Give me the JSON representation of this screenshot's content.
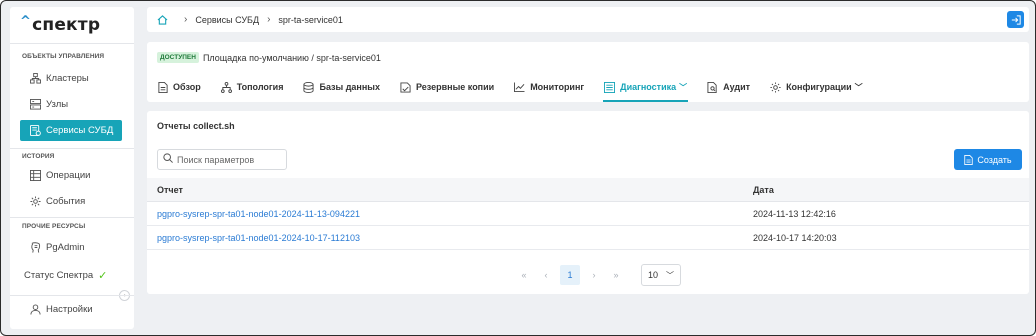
{
  "app": {
    "logo_caret": "^",
    "logo_text": "спектр"
  },
  "sidebar": {
    "sections": {
      "managed_objects": "ОБЪЕКТЫ УПРАВЛЕНИЯ",
      "history": "ИСТОРИЯ",
      "other": "ПРОЧИЕ РЕСУРСЫ"
    },
    "items": [
      {
        "label": "Кластеры",
        "icon": "cluster-icon"
      },
      {
        "label": "Узлы",
        "icon": "server-icon"
      },
      {
        "label": "Сервисы СУБД",
        "icon": "database-service-icon",
        "active": true
      },
      {
        "label": "Операции",
        "icon": "operations-icon"
      },
      {
        "label": "События",
        "icon": "events-icon"
      },
      {
        "label": "PgAdmin",
        "icon": "pgadmin-icon"
      },
      {
        "label": "Статус Спектра",
        "icon": "check-icon"
      },
      {
        "label": "Настройки",
        "icon": "user-icon"
      }
    ]
  },
  "breadcrumb": {
    "items": [
      "Сервисы СУБД",
      "spr-ta-service01"
    ]
  },
  "header": {
    "status_badge": "ДОСТУПЕН",
    "path": "Площадка по-умолчанию /  spr-ta-service01",
    "tabs": [
      {
        "label": "Обзор",
        "icon": "document-icon"
      },
      {
        "label": "Топология",
        "icon": "topology-icon"
      },
      {
        "label": "Базы данных",
        "icon": "database-icon"
      },
      {
        "label": "Резервные копии",
        "icon": "backup-icon"
      },
      {
        "label": "Мониторинг",
        "icon": "chart-icon"
      },
      {
        "label": "Диагностика",
        "icon": "diagnostics-icon",
        "active": true,
        "has_menu": true
      },
      {
        "label": "Аудит",
        "icon": "audit-icon"
      },
      {
        "label": "Конфигурации",
        "icon": "gear-icon",
        "has_menu": true
      }
    ]
  },
  "content": {
    "title": "Отчеты collect.sh",
    "search_placeholder": "Поиск параметров",
    "create_label": "Создать",
    "columns": [
      "Отчет",
      "Дата"
    ],
    "rows": [
      {
        "report": "pgpro-sysrep-spr-ta01-node01-2024-11-13-094221",
        "date": "2024-11-13 12:42:16"
      },
      {
        "report": "pgpro-sysrep-spr-ta01-node01-2024-10-17-112103",
        "date": "2024-10-17 14:20:03"
      }
    ]
  },
  "pagination": {
    "first": "«",
    "prev": "‹",
    "current_page": "1",
    "next": "›",
    "last": "»",
    "page_size": "10"
  },
  "colors": {
    "accent": "#17a4b8",
    "primary_button": "#1e88e5",
    "link": "#2a7bd4",
    "status_ok": "#52c41a"
  }
}
